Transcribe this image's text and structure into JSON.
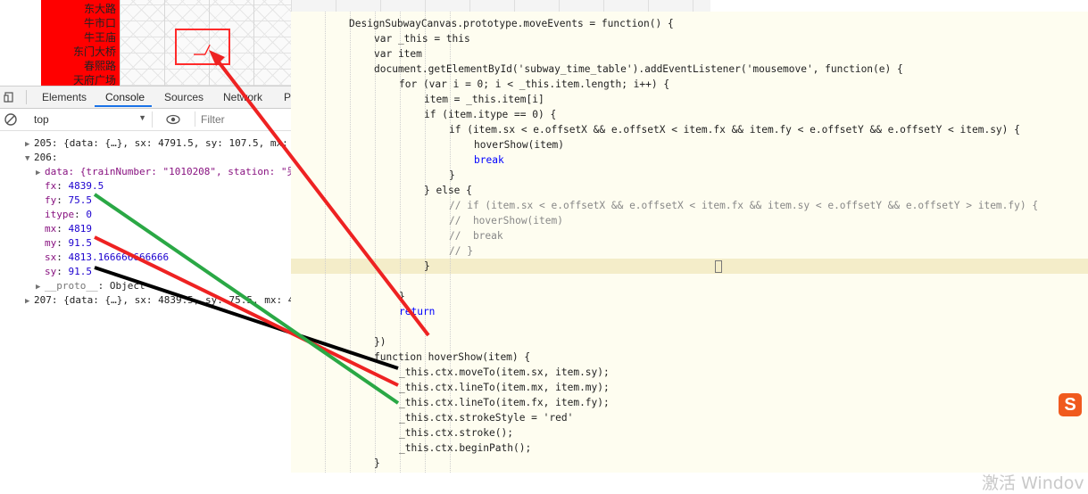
{
  "stations": [
    "东大路",
    "牛市口",
    "牛王庙",
    "东门大桥",
    "春熙路",
    "天府广场"
  ],
  "devtools": {
    "tabs": [
      {
        "label": "Elements"
      },
      {
        "label": "Console"
      },
      {
        "label": "Sources"
      },
      {
        "label": "Network"
      },
      {
        "label": "P"
      }
    ],
    "context_value": "top",
    "filter_placeholder": "Filter"
  },
  "console": {
    "entry_205": "205: {data: {…}, sx: 4791.5, sy: 107.5, mx:",
    "entry_206_label": "206:",
    "data_line": "data: {trainNumber: \"1010208\", station: \"另",
    "fields": [
      {
        "key": "fx",
        "value": "4839.5"
      },
      {
        "key": "fy",
        "value": "75.5"
      },
      {
        "key": "itype",
        "value": "0"
      },
      {
        "key": "mx",
        "value": "4819"
      },
      {
        "key": "my",
        "value": "91.5"
      },
      {
        "key": "sx",
        "value": "4813.166666666666"
      },
      {
        "key": "sy",
        "value": "91.5"
      }
    ],
    "proto_key": "__proto__",
    "proto_value": "Object",
    "entry_207": "207: {data: {…}, sx: 4839.5, sy: 75.5, mx: 4"
  },
  "code_lines": [
    "DesignSubwayCanvas.prototype.moveEvents = function() {",
    "var _this = this",
    "var item",
    "document.getElementById('subway_time_table').addEventListener('mousemove', function(e) {",
    "for (var i = 0; i < _this.item.length; i++) {",
    "item = _this.item[i]",
    "if (item.itype == 0) {",
    "if (item.sx < e.offsetX && e.offsetX < item.fx && item.fy < e.offsetY && e.offsetY < item.sy) {",
    "hoverShow(item)",
    "break",
    "}",
    "} else {",
    "// if (item.sx < e.offsetX && e.offsetX < item.fx && item.sy < e.offsetY && e.offsetY > item.fy) {",
    "//  hoverShow(item)",
    "//  break",
    "// }",
    "}",
    "}",
    "return",
    "})",
    "function hoverShow(item) {",
    "_this.ctx.moveTo(item.sx, item.sy);",
    "_this.ctx.lineTo(item.mx, item.my);",
    "_this.ctx.lineTo(item.fx, item.fy);",
    "_this.ctx.strokeStyle = 'red'",
    "_this.ctx.stroke();",
    "_this.ctx.beginPath();",
    "}"
  ],
  "ime_icon_letter": "S",
  "watermark_text": "激活 Windov",
  "colors": {
    "station_panel": "#ff0000",
    "annotation_red": "#ee2222",
    "annotation_green": "#2aa845",
    "annotation_black": "#000000",
    "editor_bg": "#fefdf0",
    "accent_blue": "#1a73e8"
  }
}
